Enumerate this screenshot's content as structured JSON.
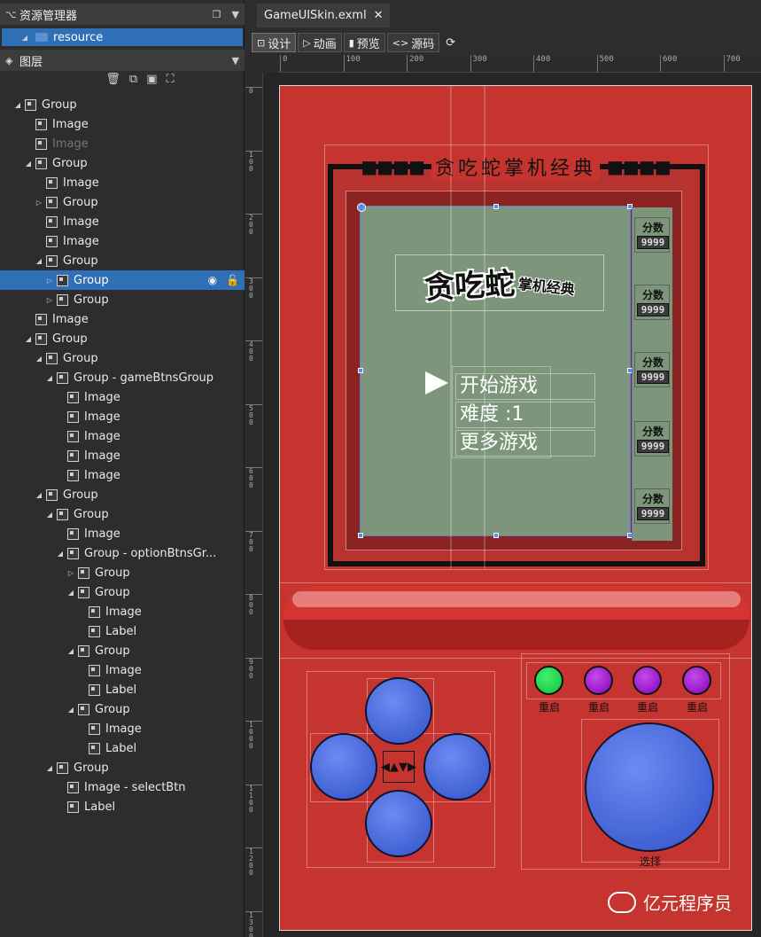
{
  "panels": {
    "resources_title": "资源管理器",
    "resource_item": "resource",
    "layers_title": "图层"
  },
  "tree": [
    {
      "label": "Group",
      "depth": 0,
      "arrow": "open"
    },
    {
      "label": "Image",
      "depth": 1,
      "arrow": ""
    },
    {
      "label": "Image",
      "depth": 1,
      "arrow": "",
      "dim": true
    },
    {
      "label": "Group",
      "depth": 1,
      "arrow": "open"
    },
    {
      "label": "Image",
      "depth": 2,
      "arrow": ""
    },
    {
      "label": "Group",
      "depth": 2,
      "arrow": "closed"
    },
    {
      "label": "Image",
      "depth": 2,
      "arrow": ""
    },
    {
      "label": "Image",
      "depth": 2,
      "arrow": ""
    },
    {
      "label": "Group",
      "depth": 2,
      "arrow": "open"
    },
    {
      "label": "Group",
      "depth": 3,
      "arrow": "closed",
      "selected": true
    },
    {
      "label": "Group",
      "depth": 3,
      "arrow": "closed"
    },
    {
      "label": "Image",
      "depth": 1,
      "arrow": ""
    },
    {
      "label": "Group",
      "depth": 1,
      "arrow": "open"
    },
    {
      "label": "Group",
      "depth": 2,
      "arrow": "open"
    },
    {
      "label": "Group - gameBtnsGroup",
      "depth": 3,
      "arrow": "open"
    },
    {
      "label": "Image",
      "depth": 4,
      "arrow": ""
    },
    {
      "label": "Image",
      "depth": 4,
      "arrow": ""
    },
    {
      "label": "Image",
      "depth": 4,
      "arrow": ""
    },
    {
      "label": "Image",
      "depth": 4,
      "arrow": ""
    },
    {
      "label": "Image",
      "depth": 4,
      "arrow": ""
    },
    {
      "label": "Group",
      "depth": 2,
      "arrow": "open"
    },
    {
      "label": "Group",
      "depth": 3,
      "arrow": "open"
    },
    {
      "label": "Image",
      "depth": 4,
      "arrow": ""
    },
    {
      "label": "Group - optionBtnsGr...",
      "depth": 4,
      "arrow": "open"
    },
    {
      "label": "Group",
      "depth": 5,
      "arrow": "closed"
    },
    {
      "label": "Group",
      "depth": 5,
      "arrow": "open"
    },
    {
      "label": "Image",
      "depth": 6,
      "arrow": ""
    },
    {
      "label": "Label",
      "depth": 6,
      "arrow": ""
    },
    {
      "label": "Group",
      "depth": 5,
      "arrow": "open"
    },
    {
      "label": "Image",
      "depth": 6,
      "arrow": ""
    },
    {
      "label": "Label",
      "depth": 6,
      "arrow": ""
    },
    {
      "label": "Group",
      "depth": 5,
      "arrow": "open"
    },
    {
      "label": "Image",
      "depth": 6,
      "arrow": ""
    },
    {
      "label": "Label",
      "depth": 6,
      "arrow": ""
    },
    {
      "label": "Group",
      "depth": 3,
      "arrow": "open"
    },
    {
      "label": "Image - selectBtn",
      "depth": 4,
      "arrow": ""
    },
    {
      "label": "Label",
      "depth": 4,
      "arrow": ""
    }
  ],
  "editor": {
    "tab": "GameUISkin.exml",
    "toolbar": {
      "design": "设计",
      "animation": "动画",
      "preview": "预览",
      "source": "源码"
    },
    "ruler_top": [
      "0",
      "100",
      "200",
      "300",
      "400",
      "500",
      "600",
      "700"
    ],
    "ruler_left": [
      "0",
      "100",
      "200",
      "300",
      "400",
      "500",
      "600",
      "700",
      "800",
      "900",
      "1000",
      "1100",
      "1200",
      "1300"
    ]
  },
  "game": {
    "title": "贪吃蛇掌机经典",
    "title_dashes": "■■■■",
    "logo_big": "贪吃蛇",
    "logo_small": "掌机经典",
    "menu": [
      "开始游戏",
      "难度 :1",
      "更多游戏"
    ],
    "scores": [
      {
        "label": "分数",
        "value": "9999"
      },
      {
        "label": "分数",
        "value": "9999"
      },
      {
        "label": "分数",
        "value": "9999"
      },
      {
        "label": "分数",
        "value": "9999"
      },
      {
        "label": "分数",
        "value": "9999"
      }
    ],
    "option_buttons": [
      {
        "label": "重启",
        "color": "#1fcf4a"
      },
      {
        "label": "重启",
        "color": "#9a17c9"
      },
      {
        "label": "重启",
        "color": "#9a17c9"
      },
      {
        "label": "重启",
        "color": "#9a17c9"
      }
    ],
    "select_label": "选择",
    "dpad_arrows": "◀▲▼▶",
    "watermark": "亿元程序员"
  },
  "colors": {
    "device_red": "#c63430",
    "lcd_green": "#7d967b",
    "button_blue": "#4a68dd",
    "selection_blue": "#2f6fb5"
  }
}
